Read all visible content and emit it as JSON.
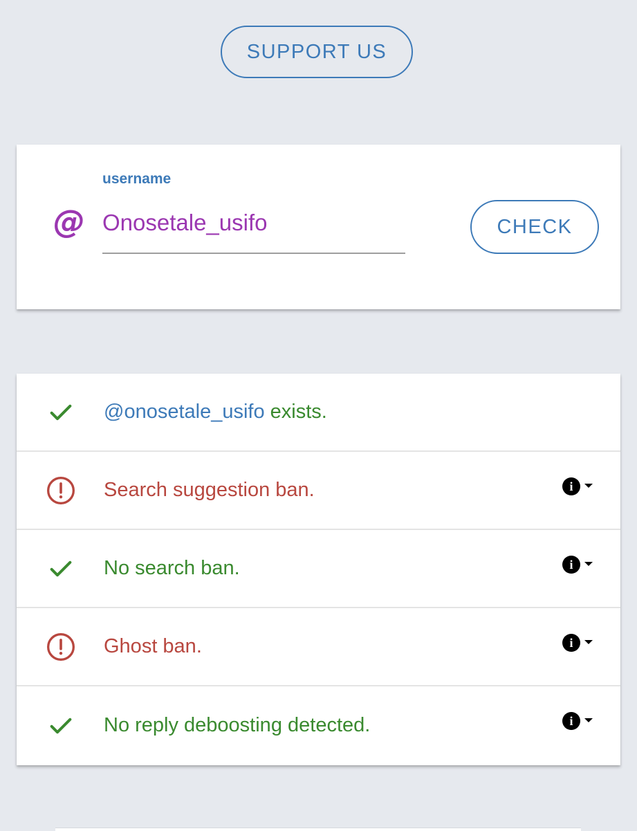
{
  "support_button": {
    "label": "SUPPORT US"
  },
  "form": {
    "at_symbol": "@",
    "field_label": "username",
    "username_value": "Onosetale_usifo",
    "check_label": "CHECK"
  },
  "results": {
    "exists": {
      "handle": "@onosetale_usifo",
      "suffix": " exists."
    },
    "items": [
      {
        "text": "Search suggestion ban.",
        "status": "warning"
      },
      {
        "text": "No search ban.",
        "status": "ok"
      },
      {
        "text": "Ghost ban.",
        "status": "warning"
      },
      {
        "text": "No reply deboosting detected.",
        "status": "ok"
      }
    ],
    "info_glyph": "i"
  },
  "colors": {
    "background": "#e6e9ee",
    "accent_blue": "#3d7ab8",
    "username_purple": "#9b37b1",
    "ok_green": "#3a8a2f",
    "warning_red": "#b8473f"
  },
  "icons": {
    "ok": "check-icon",
    "warning": "alert-circle-icon",
    "info": "info-icon",
    "expand": "caret-down-icon"
  }
}
